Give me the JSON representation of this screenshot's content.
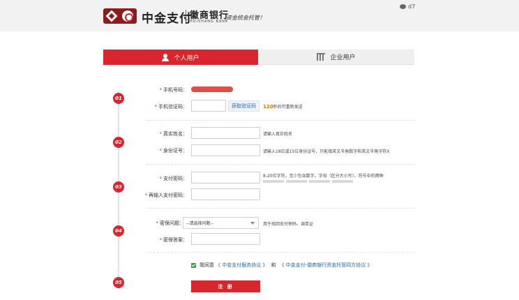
{
  "header": {
    "brand_name": "中金支付",
    "partner_name": "徽商银行",
    "partner_en": "HUISHANG BANK",
    "slogan": "资金统会托管！",
    "wechat_label": "d7"
  },
  "tabs": [
    {
      "label": "个人用户",
      "active": true
    },
    {
      "label": "企业用户",
      "active": false
    }
  ],
  "steps": [
    "01",
    "02",
    "03",
    "04",
    "05"
  ],
  "form": {
    "phone_label": "手机号码：",
    "sms_label": "手机验证码：",
    "sms_button": "获取验证码",
    "countdown_num": "120",
    "countdown_text": "秒后可重新发送",
    "name_label": "真实姓名：",
    "name_hint": "请输入真实姓名",
    "id_label": "身份证号：",
    "id_hint": "请输入18位或15位身份证号，只能填英文半角数字和英文半角字符X",
    "pwd_label": "支付密码：",
    "pwd_hint": "8-20位字符，至少包含数字、字母（区分大小写）、符号中的两种",
    "pwd_repeat_label": "再输入支付密码：",
    "question_label": "密保问题：",
    "question_selected": "--请选择问题--",
    "question_hint": "用于找回支付密码、调单证",
    "answer_label": "密保答案："
  },
  "agreement": {
    "prefix": "我同意",
    "link1": "《 中金支付服务协议 》",
    "conj": "和",
    "link2": "《 中金支付-徽商银行资金托管四方协议 》"
  },
  "submit_label": "注 册",
  "colors": {
    "primary": "#d7262e",
    "link": "#2a64a8",
    "countdown": "#e07b00",
    "checkbox": "#3fa34d"
  }
}
